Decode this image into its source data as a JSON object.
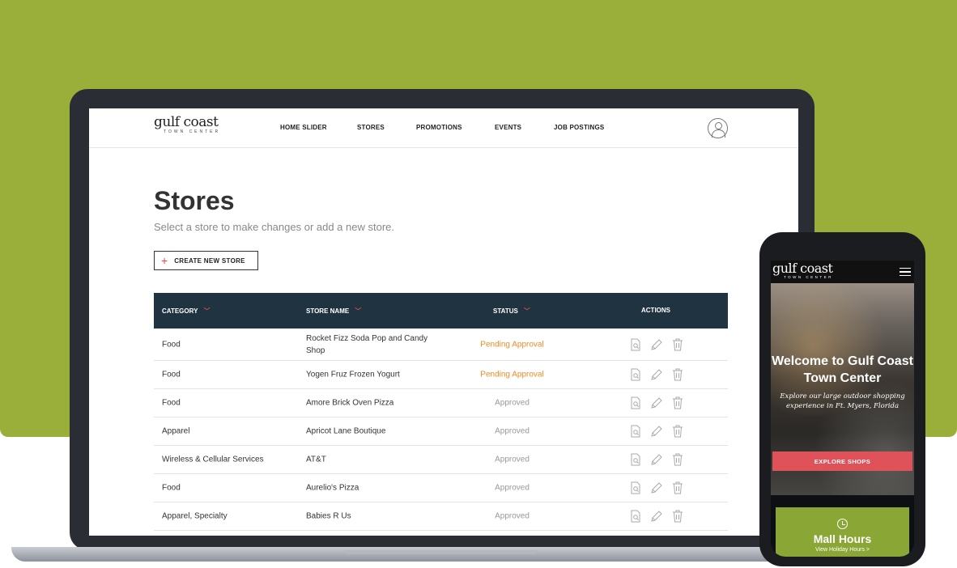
{
  "site": {
    "logo_main": "gulf coast",
    "logo_sub": "TOWN CENTER"
  },
  "nav": [
    {
      "label": "HOME SLIDER"
    },
    {
      "label": "STORES"
    },
    {
      "label": "PROMOTIONS"
    },
    {
      "label": "EVENTS"
    },
    {
      "label": "JOB POSTINGS"
    }
  ],
  "page": {
    "title": "Stores",
    "subtitle": "Select a store to make changes or add a new store.",
    "create_button": "CREATE NEW STORE"
  },
  "table": {
    "headers": {
      "category": "CATEGORY",
      "store_name": "STORE NAME",
      "status": "STATUS",
      "actions": "ACTIONS"
    },
    "rows": [
      {
        "category": "Food",
        "name": "Rocket Fizz Soda Pop and Candy Shop",
        "status": "Pending Approval",
        "state": "pending"
      },
      {
        "category": "Food",
        "name": "Yogen Fruz Frozen Yogurt",
        "status": "Pending Approval",
        "state": "pending"
      },
      {
        "category": "Food",
        "name": "Amore Brick Oven Pizza",
        "status": "Approved",
        "state": "approved"
      },
      {
        "category": "Apparel",
        "name": "Apricot Lane Boutique",
        "status": "Approved",
        "state": "approved"
      },
      {
        "category": "Wireless & Cellular Services",
        "name": "AT&T",
        "status": "Approved",
        "state": "approved"
      },
      {
        "category": "Food",
        "name": "Aurelio's Pizza",
        "status": "Approved",
        "state": "approved"
      },
      {
        "category": "Apparel, Specialty",
        "name": "Babies R Us",
        "status": "Approved",
        "state": "approved"
      }
    ]
  },
  "mobile": {
    "logo_main": "gulf coast",
    "logo_sub": "TOWN CENTER",
    "hero_title": "Welcome to Gulf Coast Town Center",
    "hero_subtitle": "Explore our large outdoor shopping experience in Ft. Myers, Florida",
    "cta": "EXPLORE SHOPS",
    "hours_title": "Mall Hours",
    "hours_link": "View Holiday Hours >"
  },
  "colors": {
    "background": "#9aaf3a",
    "table_header": "#1f3340",
    "pending": "#f08a24",
    "accent_red": "#e34a4a",
    "cta": "#e0525a",
    "hours_card": "#8aa635"
  },
  "icons": {
    "row_actions": [
      "view-document-icon",
      "edit-pencil-icon",
      "delete-trash-icon"
    ],
    "header": [
      "user-avatar-icon"
    ],
    "mobile": [
      "hamburger-menu-icon",
      "clock-icon"
    ]
  }
}
